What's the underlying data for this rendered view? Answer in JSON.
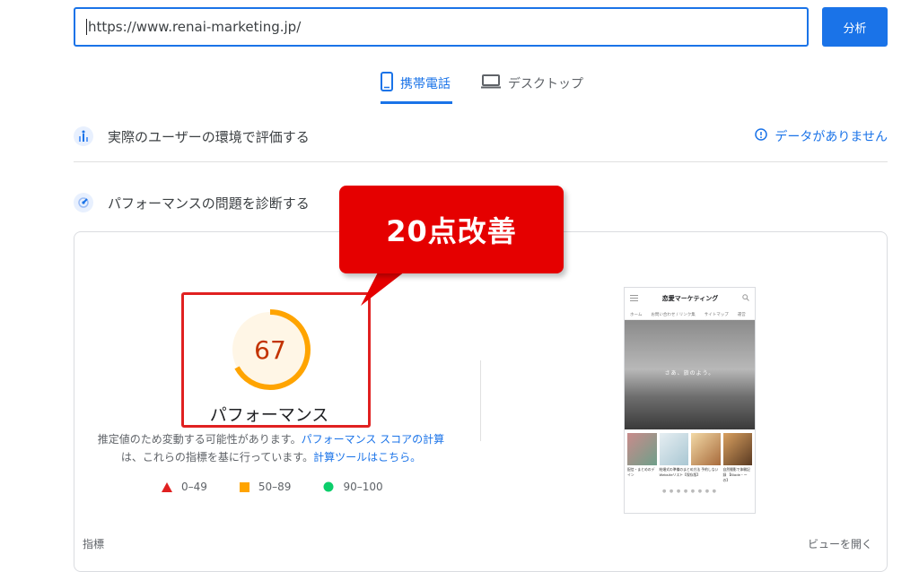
{
  "url_bar": {
    "value": "https://www.renai-marketing.jp/"
  },
  "analyze_button": {
    "label": "分析"
  },
  "tabs": [
    {
      "label": "携帯電話",
      "icon": "mobile-phone-icon",
      "selected": true
    },
    {
      "label": "デスクトップ",
      "icon": "desktop-icon",
      "selected": false
    }
  ],
  "field_data": {
    "title": "実際のユーザーの環境で評価する",
    "status": "データがありません",
    "status_icon": "info-icon"
  },
  "lab_data": {
    "title": "パフォーマンスの問題を診断する",
    "score": "67",
    "score_fraction": 0.67,
    "score_color": "#ffa400",
    "score_label": "パフォーマンス",
    "note_line1": "推定値のため変動する可能性があります。",
    "note_link1": "パフォーマンス スコアの計算",
    "note_line2": "は、これらの指標を基に行っています。",
    "note_link2": "計算ツールはこちら。",
    "legend": [
      {
        "range": "0–49",
        "shape": "triangle",
        "color": "#e02020"
      },
      {
        "range": "50–89",
        "shape": "square",
        "color": "#ffa400"
      },
      {
        "range": "90–100",
        "shape": "circle",
        "color": "#0cce6b"
      }
    ]
  },
  "callout": {
    "text": "20点改善",
    "color": "#e50000"
  },
  "phone_preview": {
    "site_title": "恋愛マーケティング",
    "nav": [
      "ホーム",
      "お問い合わせ / リンク集",
      "サイトマップ",
      "運営"
    ],
    "hero_text": "さあ、旅のよう。",
    "captions": [
      "配信・まとめのデイン",
      "結婚式の準備のまとめ方法 予約しない Websiteリスト【保存版】",
      "自然撮影で体験記録 【Blade・ーの】"
    ]
  },
  "footer": {
    "left": "指標",
    "right": "ビューを開く"
  }
}
